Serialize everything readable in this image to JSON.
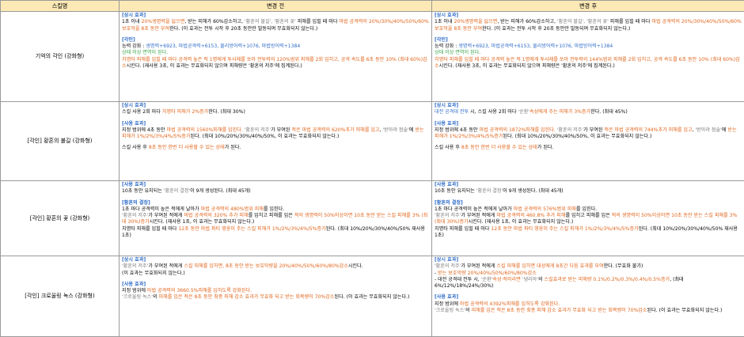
{
  "header": {
    "col_skill": "스킬명",
    "col_before": "변경 전",
    "col_after": "변경 후"
  },
  "rows": [
    {
      "name": "기억의 각인 (강화형)",
      "before": [
        [
          [
            "hd",
            "[상시 효과]"
          ]
        ],
        [
          [
            "",
            "1초 이내 "
          ],
          [
            "or",
            "20%생명력을 잃으면"
          ],
          [
            "",
            ", 받는 피해가 60%감소하고, "
          ],
          [
            "gy",
            "'황혼의 불길', '황혼의 꽃'"
          ],
          [
            "",
            " 피해를 입힐 때 마다 "
          ],
          [
            "or",
            "마법 공격력의 20%/30%/40%/50%/60%보호막을 8초 동안 부여"
          ],
          [
            "",
            "한다. (이 효과는 전투 시작 후 20초 동안만 발동되며 무효화되지 않는다.)"
          ]
        ],
        [],
        [
          [
            "hd",
            "[각인]"
          ]
        ],
        [
          [
            "",
            "능력 강화 : "
          ],
          [
            "bl",
            "생명력+6923, 마법공격력+6153, 물리방어력+1076, 마법방어력+1384"
          ]
        ],
        [
          [
            "gr",
            "상태 이상 면역이 된다."
          ]
        ],
        [
          [
            "or",
            "치명타 피해를 입힐 때 마다 공격력 높은 적 1명에게 투사체를 쏘아 전투력의 120%범위 피해를 2회 입히고, 공격 속도를 6초 동안 10% (최대 60%)감소"
          ],
          [
            "",
            "시킨다. (재사용 3초, 이 효과는 무효화되지 않으며 피해량은 '황혼의 저주'에 집계된다.)"
          ]
        ]
      ],
      "after": [
        [
          [
            "hd",
            "[상시 효과]"
          ]
        ],
        [
          [
            "",
            "1초 이내 "
          ],
          [
            "or",
            "20%생명력을 잃으면"
          ],
          [
            "",
            ", 받는 피해가 60%감소하고, "
          ],
          [
            "gy",
            "'황혼의 불길', '황혼의 꽃'"
          ],
          [
            "",
            " 피해를 입힐 때 마다 "
          ],
          [
            "or",
            "마법 공격력의 20%/30%/40%/50%/60%보호막을 8초 동안 부여"
          ],
          [
            "",
            "한다. (이 효과는 전투 시작 후 20초 동안만 발동되며 무효화되지 않는다.)"
          ]
        ],
        [],
        [
          [
            "hd",
            "[각인]"
          ]
        ],
        [
          [
            "",
            "능력 강화 : "
          ],
          [
            "bl",
            "생명력+6923, 마법공격력+6153, 물리방어력+1076, 마법방어력+1384"
          ]
        ],
        [
          [
            "gr",
            "상태 이상 면역이 된다."
          ]
        ],
        [
          [
            "or",
            "치명타 피해를 입힐 때 마다 공격력 높은 적 1명에게 투사체를 쏘아 전투력의 144%범위 피해를 2회 입히고, 공격 속도를 6초 동안 10% (최대 60%)감소"
          ],
          [
            "",
            "시킨다. (재사용 3초, 이 효과는 무효화되지 않으며 피해량은 '황혼의 저주'에 집계된다.)"
          ]
        ]
      ]
    },
    {
      "name": "[각인] 황혼의 불길 (강화형)",
      "before": [
        [
          [
            "hd",
            "[상시 효과]"
          ]
        ],
        [
          [
            "",
            "스킬 사용 2회 마다 "
          ],
          [
            "or",
            "치명타 피해가 2%증가"
          ],
          [
            "",
            "한다. (최대 30%)"
          ]
        ],
        [],
        [
          [
            "hd",
            "[사용 효과]"
          ]
        ],
        [
          [
            "",
            "지정 범위에 4초 동안 "
          ],
          [
            "or",
            "마법 공격력의 1560%피해를 입힌다."
          ],
          [
            "",
            " "
          ],
          [
            "gy",
            "'황혼의 저주'"
          ],
          [
            "",
            "가 부여된 "
          ],
          [
            "or",
            "적은 마법 공격력의 620%추가 피해를 입고"
          ],
          [
            "",
            ", "
          ],
          [
            "gy",
            "'받아랴 점술'"
          ],
          [
            "",
            "에 "
          ],
          [
            "or",
            "받는 피해가 1%/2%/3%/4%/5%증가"
          ],
          [
            "",
            "된다. (최대 10%/20%/30%/40%/50%, 이 효과는 무효화되지 않는다.)"
          ]
        ],
        [],
        [
          [
            "",
            "스킬 사용 후 "
          ],
          [
            "or",
            "8초 동안 한번 더 사용할 수 있는 상태"
          ],
          [
            "",
            "가 된다."
          ]
        ]
      ],
      "after": [
        [
          [
            "hd",
            "[상시 효과]"
          ]
        ],
        [
          [
            "bl",
            "대전 공격대 전투"
          ],
          [
            "",
            " 시, 스킬 사용 2회 마다 "
          ],
          [
            "gy",
            "'순환'"
          ],
          [
            "",
            ""
          ],
          [
            "or",
            "속성에게 주는 피해가 3%증가"
          ],
          [
            "",
            "한다. (최대 45%)"
          ]
        ],
        [],
        [
          [
            "hd",
            "[사용 효과]"
          ]
        ],
        [
          [
            "",
            "지정 범위에 4초 동안 "
          ],
          [
            "or",
            "마법 공격력의 1872%피해를 입힌다."
          ],
          [
            "",
            " "
          ],
          [
            "gy",
            "'황혼의 저주'"
          ],
          [
            "",
            "가 부여된 "
          ],
          [
            "or",
            "적은 마법 공격력의 744%추가 피해를 입고"
          ],
          [
            "",
            ", "
          ],
          [
            "gy",
            "'받아랴 점술'"
          ],
          [
            "",
            "에 "
          ],
          [
            "or",
            "받는 피해가 1%/2%/3%/4%/5%증가"
          ],
          [
            "",
            "된다. (최대 10%/20%/30%/40%/50%, 이 효과는 무효화되지 않는다.)"
          ]
        ],
        [],
        [
          [
            "",
            "스킬 사용 후 "
          ],
          [
            "or",
            "8초 동안 한번 더 사용할 수 있는 상태"
          ],
          [
            "",
            "가 된다."
          ]
        ]
      ]
    },
    {
      "name": "[각인] 황혼의 꽃 (강화형)",
      "before": [
        [
          [
            "hd",
            "[사용 효과]"
          ]
        ],
        [
          [
            "",
            "10초 동안 유지되는 "
          ],
          [
            "gy",
            "'황혼의 결정'"
          ],
          [
            "",
            "이 9개 생성된다. (최대 45개)"
          ]
        ],
        [],
        [
          [
            "hd",
            "[황혼의 결정]"
          ]
        ],
        [
          [
            "",
            "1초 마다 공격력이 높은 적에게 날아가 "
          ],
          [
            "or",
            "마법 공격력의 480%범위 피해"
          ],
          [
            "",
            "를 입힌다."
          ]
        ],
        [
          [
            "gy",
            "'황혼의 저주'"
          ],
          [
            "",
            "가 부여된 적에게 "
          ],
          [
            "or",
            "마법 공격력의 320% 추가 피해"
          ],
          [
            "",
            "를 입히고 피해를 입은 "
          ],
          [
            "or",
            "적의 생명력이 50%이상이면 10초 동안 받는 스킬 피해를 3% (최대 30%)증가"
          ],
          [
            "",
            "시킨다. (재사용 1초, 이 효과는 무효화되지 않는다.)"
          ]
        ],
        [
          [
            "",
            "치명타 피해를 입힐 때 마다 "
          ],
          [
            "or",
            "12초 동안 마법 파티 영웅이 주는 스킬 피해가 1%/2%/3%/4%/5%증가"
          ],
          [
            "",
            "된다. (최대 10%/20%/30%/40%/50% 재사용 1초)"
          ]
        ]
      ],
      "after": [
        [
          [
            "hd",
            "[사용 효과]"
          ]
        ],
        [
          [
            "",
            "10초 동안 유지되는 "
          ],
          [
            "gy",
            "'황혼의 결정'"
          ],
          [
            "",
            "이 9개 생성된다. (최대 45개)"
          ]
        ],
        [],
        [
          [
            "hd",
            "[황혼의 결정]"
          ]
        ],
        [
          [
            "",
            "1초 마다 공격력이 높은 적에게 날아가 "
          ],
          [
            "or",
            "마법 공격력의 576%범위 피해"
          ],
          [
            "",
            "를 입힌다."
          ]
        ],
        [
          [
            "gy",
            "'황혼의 저주'"
          ],
          [
            "",
            "가 부여된 적에게 "
          ],
          [
            "or",
            "마법 공격력의 460.8% 추가 피해"
          ],
          [
            "",
            "를 입히고 피해를 입은 "
          ],
          [
            "or",
            "적의 생명력이 50%이상이면 10초 동안 받는 스킬 피해를 3% (최대 30%)증가"
          ],
          [
            "",
            "시킨다. (재사용 1초, 이 효과는 무효화되지 않는다.)"
          ]
        ],
        [
          [
            "",
            "치명타 피해를 입힐 때 마다 "
          ],
          [
            "or",
            "12초 동안 마법 파티 영웅이 주는 스킬 피해가 1%/2%/3%/4%/5%증가"
          ],
          [
            "",
            "된다. (최대 10%/20%/30%/40%/50% 재사용 1초)"
          ]
        ]
      ]
    },
    {
      "name": "[각인] 크로울링 녹스 (강화형)",
      "before": [
        [
          [
            "hd",
            "[상시 효과]"
          ]
        ],
        [
          [
            "gy",
            "'황혼의 저주'"
          ],
          [
            "",
            "가 부여된 적에게 "
          ],
          [
            "or",
            "스킬 피해를 입히면, 8초 동안 받는 보호막량을 20%/40%/50%/60%/80%감소"
          ],
          [
            "",
            "시킨다."
          ]
        ],
        [
          [
            "",
            "(이 효과는 무효화되지 않는다.)"
          ]
        ],
        [],
        [
          [
            "hd",
            "[사용 효과]"
          ]
        ],
        [
          [
            "",
            "지정 범위에 "
          ],
          [
            "or",
            "마법 공격력의 3660.5%피해를 입히도록 강화된다."
          ]
        ],
        [
          [
            "gy",
            "'크로울링 녹스'"
          ],
          [
            "",
            "의 "
          ],
          [
            "or",
            "피해를 입은 적은 8초 동안 최종 피해 감소 효과가 무효화 되고 받는 회복량이 70%감소"
          ],
          [
            "",
            "된다. (이 효과는 무효화되지 않는다.)"
          ]
        ]
      ],
      "after": [
        [
          [
            "hd",
            "[상시 효과]"
          ]
        ],
        [
          [
            "gy",
            "'황혼의 저주'"
          ],
          [
            "",
            "가 부여된 적에게 "
          ],
          [
            "or",
            "스킬 피해를 입히면 대상에게 8초간 다음 효과를 부여"
          ],
          [
            "",
            "한다. (무효화 불가)"
          ]
        ],
        [
          [
            "",
            "- "
          ],
          [
            "or",
            "받는 보호막량 20%/40%/50%/60%/80%감소"
          ]
        ],
        [
          [
            "",
            "- 대전 공격대 전투 시, "
          ],
          [
            "gy",
            "'순환'"
          ],
          [
            "or",
            "속성·적이라면 "
          ],
          [
            "gy",
            "'냉리아'"
          ],
          [
            "",
            "의 "
          ],
          [
            "or",
            "스킬효과로 받는 피해량 0.1%/0.2%/0.3%/0.4%/0.5%증가"
          ],
          [
            "",
            ", (최대 6%/12%/18%/24%/30%)"
          ]
        ],
        [],
        [
          [
            "hd",
            "[사용 효과]"
          ]
        ],
        [
          [
            "",
            "지정 범위에 "
          ],
          [
            "or",
            "마법 공격력의 4392%피해를 입히도록 강화된다."
          ]
        ],
        [
          [
            "gy",
            "'크로울링 녹스'"
          ],
          [
            "",
            "의 "
          ],
          [
            "or",
            "피해를 입은 적은 8초 동안 최종 피해 감소 효과가 무효화 되고 받는 회복량이 70%감소"
          ],
          [
            "",
            "된다. (이 효과는 무효화되지 않는다.)"
          ]
        ]
      ]
    }
  ]
}
